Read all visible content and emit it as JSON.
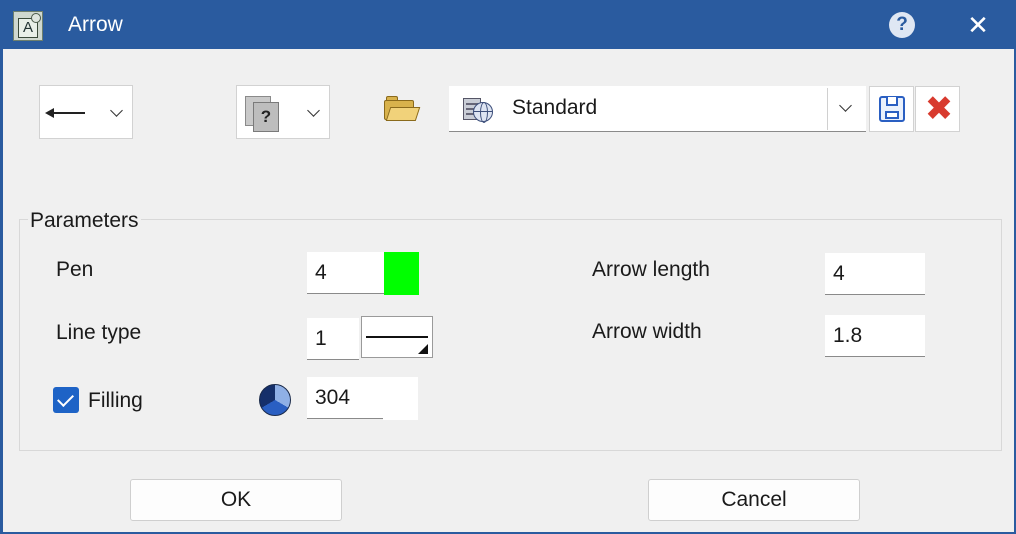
{
  "window": {
    "title": "Arrow",
    "help_icon": "?",
    "close_icon": "✕",
    "app_icon_letter": "A"
  },
  "toolbar": {
    "arrow_style_combo": {
      "icon": "arrow-left-icon"
    },
    "layer_combo": {
      "icon": "layer-unknown-icon",
      "glyph": "?"
    },
    "open_icon": "folder-open-icon",
    "standard": {
      "value": "Standard",
      "icon": "globe-server-icon"
    },
    "save_icon": "floppy-save-icon",
    "delete_icon": "red-x-delete-icon",
    "delete_glyph": "✖"
  },
  "parameters": {
    "group_title": "Parameters",
    "pen": {
      "label": "Pen",
      "value": "4",
      "color": "#00ff00"
    },
    "line_type": {
      "label": "Line type",
      "value": "1"
    },
    "filling": {
      "label": "Filling",
      "checked": true,
      "value": "304",
      "color": "#ffffff"
    },
    "arrow_length": {
      "label": "Arrow length",
      "value": "4"
    },
    "arrow_width": {
      "label": "Arrow width",
      "value": "1.8"
    }
  },
  "buttons": {
    "ok": "OK",
    "cancel": "Cancel"
  },
  "colors": {
    "titlebar": "#2a5b9f",
    "dialog_bg": "#f0f0f0",
    "accent": "#1e63c6",
    "pen_green": "#00ff00"
  }
}
